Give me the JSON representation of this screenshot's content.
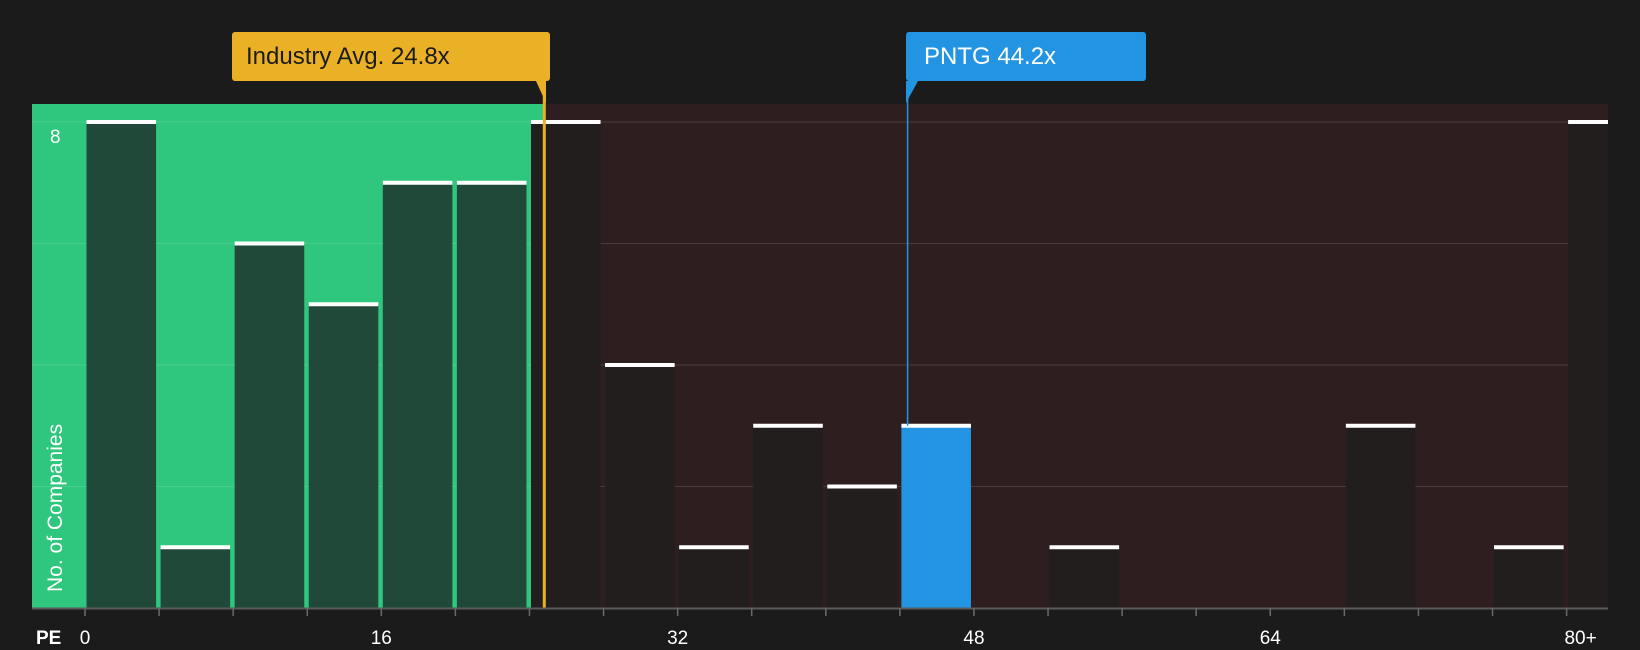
{
  "chart_data": {
    "type": "bar",
    "xlabel": "PE",
    "ylabel": "No. of Companies",
    "x_ticks": [
      "0",
      "16",
      "32",
      "48",
      "64",
      "80+"
    ],
    "y_ticks": [
      "8"
    ],
    "ylim": [
      0,
      8
    ],
    "grid": true,
    "bins": [
      {
        "x_start": 0,
        "x_end": 4,
        "value": 8
      },
      {
        "x_start": 4,
        "x_end": 8,
        "value": 1
      },
      {
        "x_start": 8,
        "x_end": 12,
        "value": 6
      },
      {
        "x_start": 12,
        "x_end": 16,
        "value": 5
      },
      {
        "x_start": 16,
        "x_end": 20,
        "value": 7
      },
      {
        "x_start": 20,
        "x_end": 24,
        "value": 7
      },
      {
        "x_start": 24,
        "x_end": 28,
        "value": 8
      },
      {
        "x_start": 28,
        "x_end": 32,
        "value": 4
      },
      {
        "x_start": 32,
        "x_end": 36,
        "value": 1
      },
      {
        "x_start": 36,
        "x_end": 40,
        "value": 3
      },
      {
        "x_start": 40,
        "x_end": 44,
        "value": 2
      },
      {
        "x_start": 44,
        "x_end": 48,
        "value": 3,
        "highlight": true
      },
      {
        "x_start": 48,
        "x_end": 52,
        "value": 0
      },
      {
        "x_start": 52,
        "x_end": 56,
        "value": 1
      },
      {
        "x_start": 56,
        "x_end": 60,
        "value": 0
      },
      {
        "x_start": 60,
        "x_end": 64,
        "value": 0
      },
      {
        "x_start": 64,
        "x_end": 68,
        "value": 0
      },
      {
        "x_start": 68,
        "x_end": 72,
        "value": 3
      },
      {
        "x_start": 72,
        "x_end": 76,
        "value": 0
      },
      {
        "x_start": 76,
        "x_end": 80,
        "value": 1
      },
      {
        "x_start": 80,
        "x_end": 82,
        "value": 8
      }
    ],
    "markers": {
      "industry": {
        "label": "Industry Avg. 24.8x",
        "value": 24.8,
        "color": "#eab026"
      },
      "company": {
        "label": "PNTG 44.2x",
        "value": 44.2,
        "color": "#2394e1"
      }
    },
    "colors": {
      "background": "#1b1b1b",
      "below_region": "#2fc77e",
      "above_region": "#2e1e1f",
      "bar_in_green": "#20493a",
      "bar_dark": "#221e1e",
      "highlight_bar": "#2394e1",
      "bar_cap": "#ffffff",
      "text": "#ffffff"
    }
  }
}
